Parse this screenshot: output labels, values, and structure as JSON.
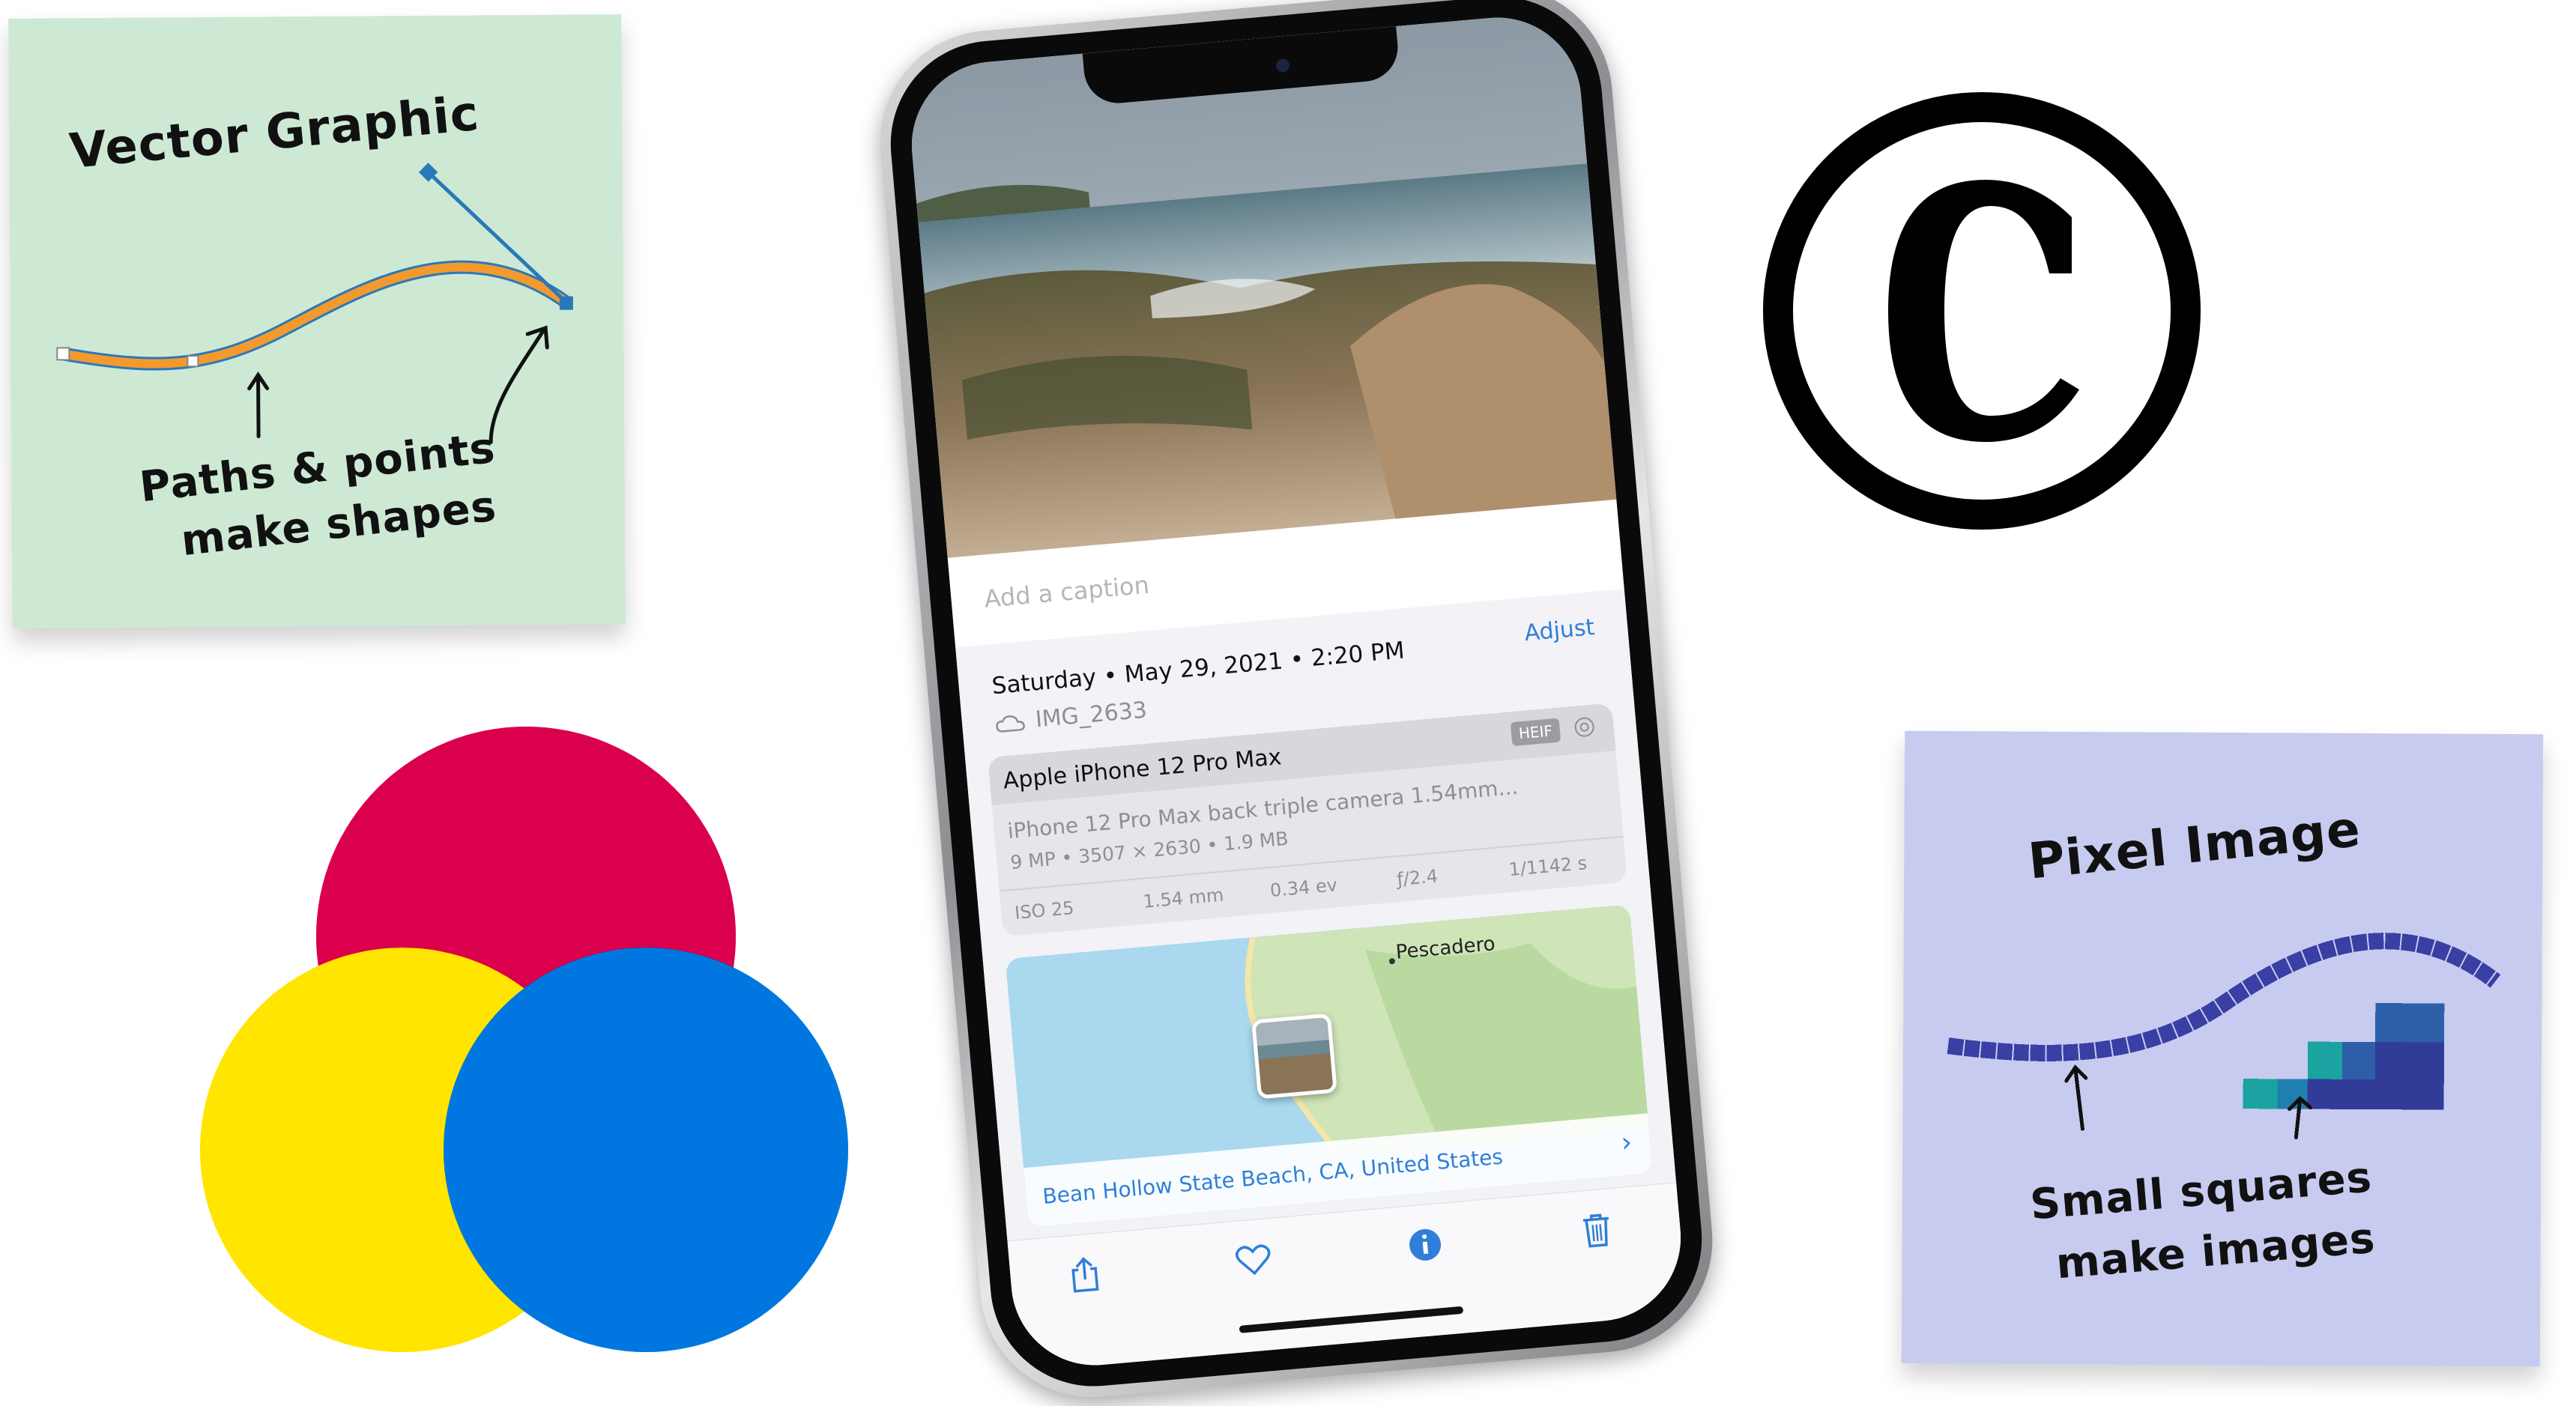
{
  "vector_note": {
    "title": "Vector Graphic",
    "line1": "Paths & points",
    "line2": "make shapes",
    "bg_color": "#cde9d4",
    "curve_color": "#f29a2e",
    "handle_color": "#2b78b9"
  },
  "pixel_note": {
    "title": "Pixel Image",
    "line1": "Small squares",
    "line2": "make images",
    "bg_color": "#c7cbef",
    "stroke_color": "#3a3fa4"
  },
  "copyright_icon": "copyright-icon",
  "phone": {
    "caption_placeholder": "Add a caption",
    "date": "Saturday  •  May 29, 2021  •  2:20 PM",
    "adjust_label": "Adjust",
    "filename": "IMG_2633",
    "exif": {
      "model": "Apple iPhone 12 Pro Max",
      "format_badge": "HEIF",
      "lens": "iPhone 12 Pro Max back triple camera 1.54mm...",
      "size_info": "9 MP  •  3507 × 2630  •  1.9 MB",
      "specs": [
        "ISO 25",
        "1.54 mm",
        "0.34 ev",
        "ƒ/2.4",
        "1/1142 s"
      ]
    },
    "map": {
      "place": "Pescadero",
      "location_label": "Bean Hollow State Beach, CA, United States"
    },
    "toolbar": [
      "share-icon",
      "heart-icon",
      "info-icon",
      "trash-icon"
    ],
    "accent_color": "#2f7fd8"
  },
  "venn_colors": [
    "#ec008c",
    "#fff200",
    "#00aeef"
  ]
}
